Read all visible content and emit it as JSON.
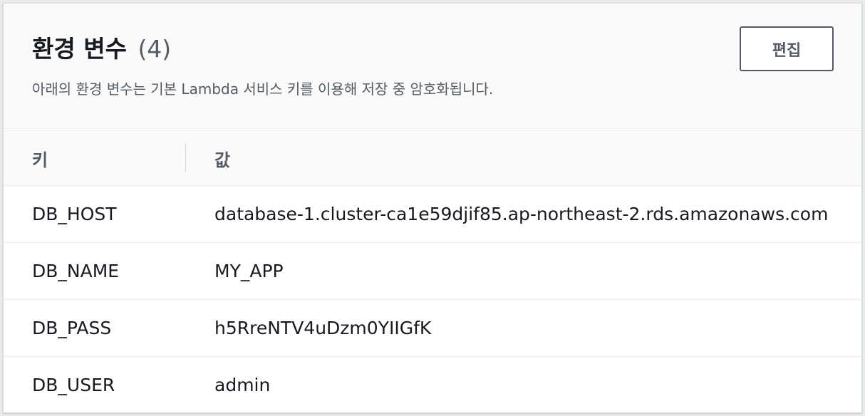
{
  "header": {
    "title": "환경 변수",
    "count": "(4)",
    "description": "아래의 환경 변수는 기본 Lambda 서비스 키를 이용해 저장 중 암호화됩니다.",
    "edit_label": "편집"
  },
  "table": {
    "columns": [
      "키",
      "값"
    ],
    "rows": [
      {
        "key": "DB_HOST",
        "value": "database-1.cluster-ca1e59djif85.ap-northeast-2.rds.amazonaws.com"
      },
      {
        "key": "DB_NAME",
        "value": "MY_APP"
      },
      {
        "key": "DB_PASS",
        "value": "h5RreNTV4uDzm0YIIGfK"
      },
      {
        "key": "DB_USER",
        "value": "admin"
      }
    ]
  }
}
